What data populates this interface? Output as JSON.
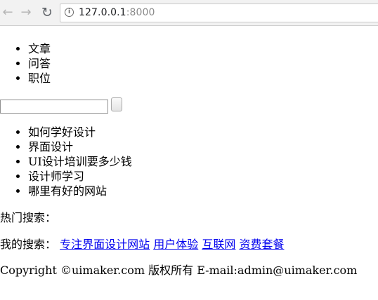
{
  "browser": {
    "back_icon": "←",
    "forward_icon": "→",
    "reload_icon": "↻",
    "info_icon": "i",
    "url_host": "127.0.0.1",
    "url_port": ":8000"
  },
  "menu": [
    "文章",
    "问答",
    "职位"
  ],
  "search": {
    "input_value": "",
    "button_label": ""
  },
  "suggestions": [
    "如何学好设计",
    "界面设计",
    "UI设计培训要多少钱",
    "设计师学习",
    "哪里有好的网站"
  ],
  "hot_search_label": "热门搜索：",
  "my_search": {
    "label": "我的搜索：",
    "links": [
      "专注界面设计网站",
      "用户体验",
      "互联网",
      "资费套餐"
    ]
  },
  "copyright": "Copyright ©uimaker.com 版权所有 E-mail:admin@uimaker.com"
}
